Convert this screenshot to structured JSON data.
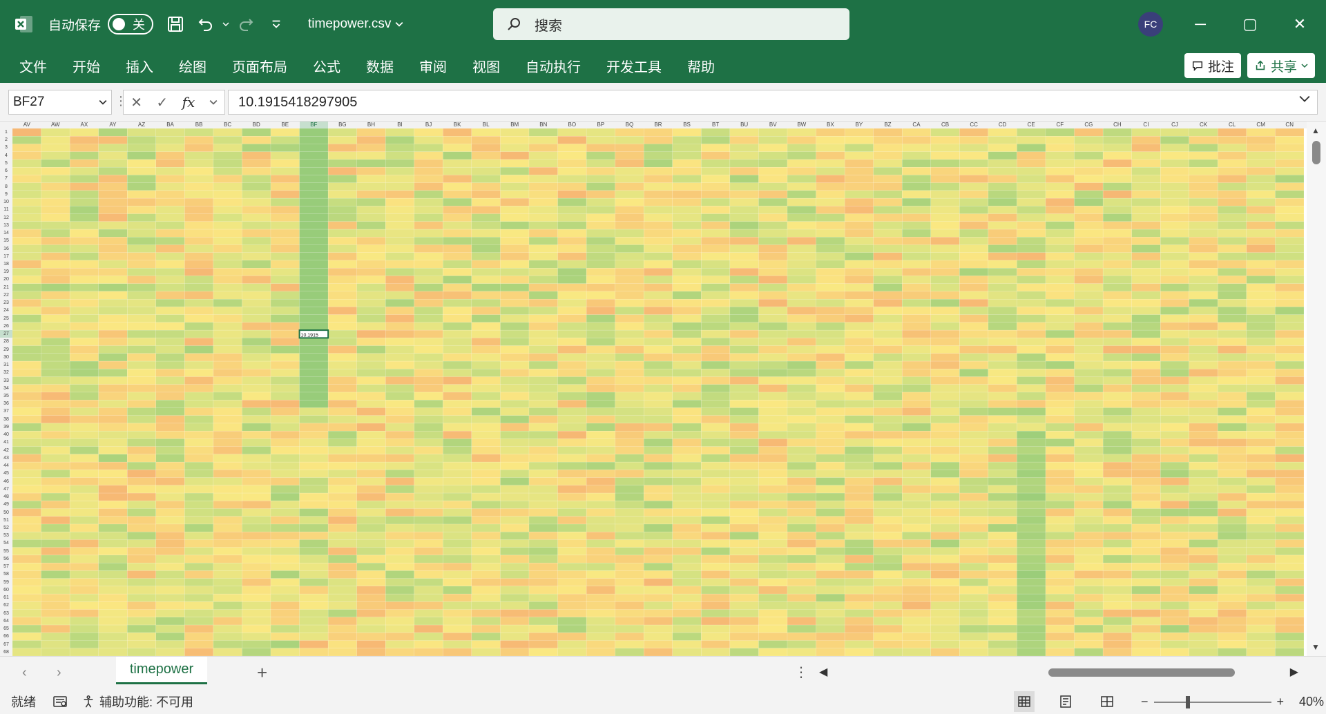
{
  "titlebar": {
    "autosave_label": "自动保存",
    "toggle_label": "关",
    "filename": "timepower.csv",
    "search_placeholder": "搜索",
    "avatar_initials": "FC",
    "minimize": "─",
    "restore": "▢",
    "close": "✕"
  },
  "ribbon": {
    "tabs": [
      "文件",
      "开始",
      "插入",
      "绘图",
      "页面布局",
      "公式",
      "数据",
      "审阅",
      "视图",
      "自动执行",
      "开发工具",
      "帮助"
    ],
    "comment_label": "批注",
    "share_label": "共享"
  },
  "formula": {
    "namebox": "BF27",
    "fx": "fx",
    "value": "10.1915418297905"
  },
  "grid": {
    "columns": [
      "AV",
      "AW",
      "AX",
      "AY",
      "AZ",
      "BA",
      "BB",
      "BC",
      "BD",
      "BE",
      "BF",
      "BG",
      "BH",
      "BI",
      "BJ",
      "BK",
      "BL",
      "BM",
      "BN",
      "BO",
      "BP",
      "BQ",
      "BR",
      "BS",
      "BT",
      "BU",
      "BV",
      "BW",
      "BX",
      "BY",
      "BZ",
      "CA",
      "CB",
      "CC",
      "CD",
      "CE",
      "CF",
      "CG",
      "CH",
      "CI",
      "CJ",
      "CK",
      "CL",
      "CM",
      "CN"
    ],
    "first_row": 1,
    "row_count": 68,
    "selected_column": "BF",
    "selected_row": 27,
    "selected_value": "10.1915"
  },
  "sheets": {
    "active": "timepower",
    "prev": "‹",
    "next": "›",
    "add": "+",
    "more": "⋮"
  },
  "status": {
    "ready": "就绪",
    "accessibility": "辅助功能: 不可用",
    "zoom": "40%",
    "zoom_minus": "−",
    "zoom_plus": "+"
  }
}
